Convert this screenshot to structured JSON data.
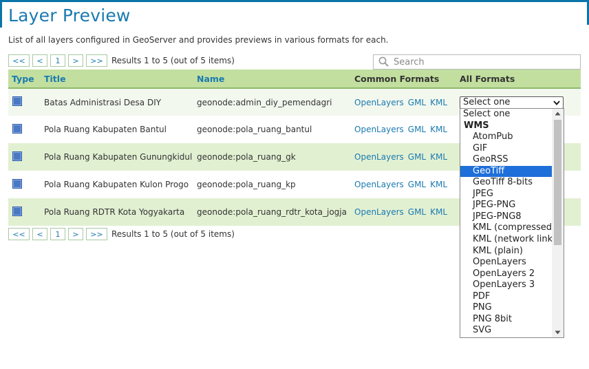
{
  "page": {
    "title": "Layer Preview",
    "description": "List of all layers configured in GeoServer and provides previews in various formats for each."
  },
  "pager": {
    "first": "<<",
    "prev": "<",
    "current": "1",
    "next": ">",
    "last": ">>",
    "summary": "Results 1 to 5 (out of 5 items)"
  },
  "search": {
    "placeholder": "Search",
    "value": ""
  },
  "table": {
    "headers": {
      "type": "Type",
      "title": "Title",
      "name": "Name",
      "common": "Common Formats",
      "all": "All Formats"
    },
    "rows": [
      {
        "title": "Batas Administrasi Desa DIY",
        "name": "geonode:admin_diy_pemendagri",
        "formats": [
          "OpenLayers",
          "GML",
          "KML"
        ]
      },
      {
        "title": "Pola Ruang Kabupaten Bantul",
        "name": "geonode:pola_ruang_bantul",
        "formats": [
          "OpenLayers",
          "GML",
          "KML"
        ]
      },
      {
        "title": "Pola Ruang Kabupaten Gunungkidul",
        "name": "geonode:pola_ruang_gk",
        "formats": [
          "OpenLayers",
          "GML",
          "KML"
        ]
      },
      {
        "title": "Pola Ruang Kabupaten Kulon Progo",
        "name": "geonode:pola_ruang_kp",
        "formats": [
          "OpenLayers",
          "GML",
          "KML"
        ]
      },
      {
        "title": "Pola Ruang RDTR Kota Yogyakarta",
        "name": "geonode:pola_ruang_rdtr_kota_jogja",
        "formats": [
          "OpenLayers",
          "GML",
          "KML"
        ]
      }
    ]
  },
  "select": {
    "value": "Select one",
    "options": [
      {
        "label": "Select one",
        "kind": "top-level"
      },
      {
        "label": "WMS",
        "kind": "group"
      },
      {
        "label": "AtomPub",
        "kind": "child"
      },
      {
        "label": "GIF",
        "kind": "child"
      },
      {
        "label": "GeoRSS",
        "kind": "child"
      },
      {
        "label": "GeoTiff",
        "kind": "child",
        "selected": true
      },
      {
        "label": "GeoTiff 8-bits",
        "kind": "child"
      },
      {
        "label": "JPEG",
        "kind": "child"
      },
      {
        "label": "JPEG-PNG",
        "kind": "child"
      },
      {
        "label": "JPEG-PNG8",
        "kind": "child"
      },
      {
        "label": "KML (compressed)",
        "kind": "child"
      },
      {
        "label": "KML (network link)",
        "kind": "child"
      },
      {
        "label": "KML (plain)",
        "kind": "child"
      },
      {
        "label": "OpenLayers",
        "kind": "child"
      },
      {
        "label": "OpenLayers 2",
        "kind": "child"
      },
      {
        "label": "OpenLayers 3",
        "kind": "child"
      },
      {
        "label": "PDF",
        "kind": "child"
      },
      {
        "label": "PNG",
        "kind": "child"
      },
      {
        "label": "PNG 8bit",
        "kind": "child"
      },
      {
        "label": "SVG",
        "kind": "child"
      }
    ]
  },
  "icons": {
    "layer": "polygon-layer-icon",
    "search": "search-icon",
    "dropdown": "chevron-down-icon"
  },
  "colors": {
    "accent": "#1a7ab0",
    "header_bg": "#c2df9f",
    "row_alt": "#e2f0d2",
    "selection": "#1e6fd9"
  }
}
